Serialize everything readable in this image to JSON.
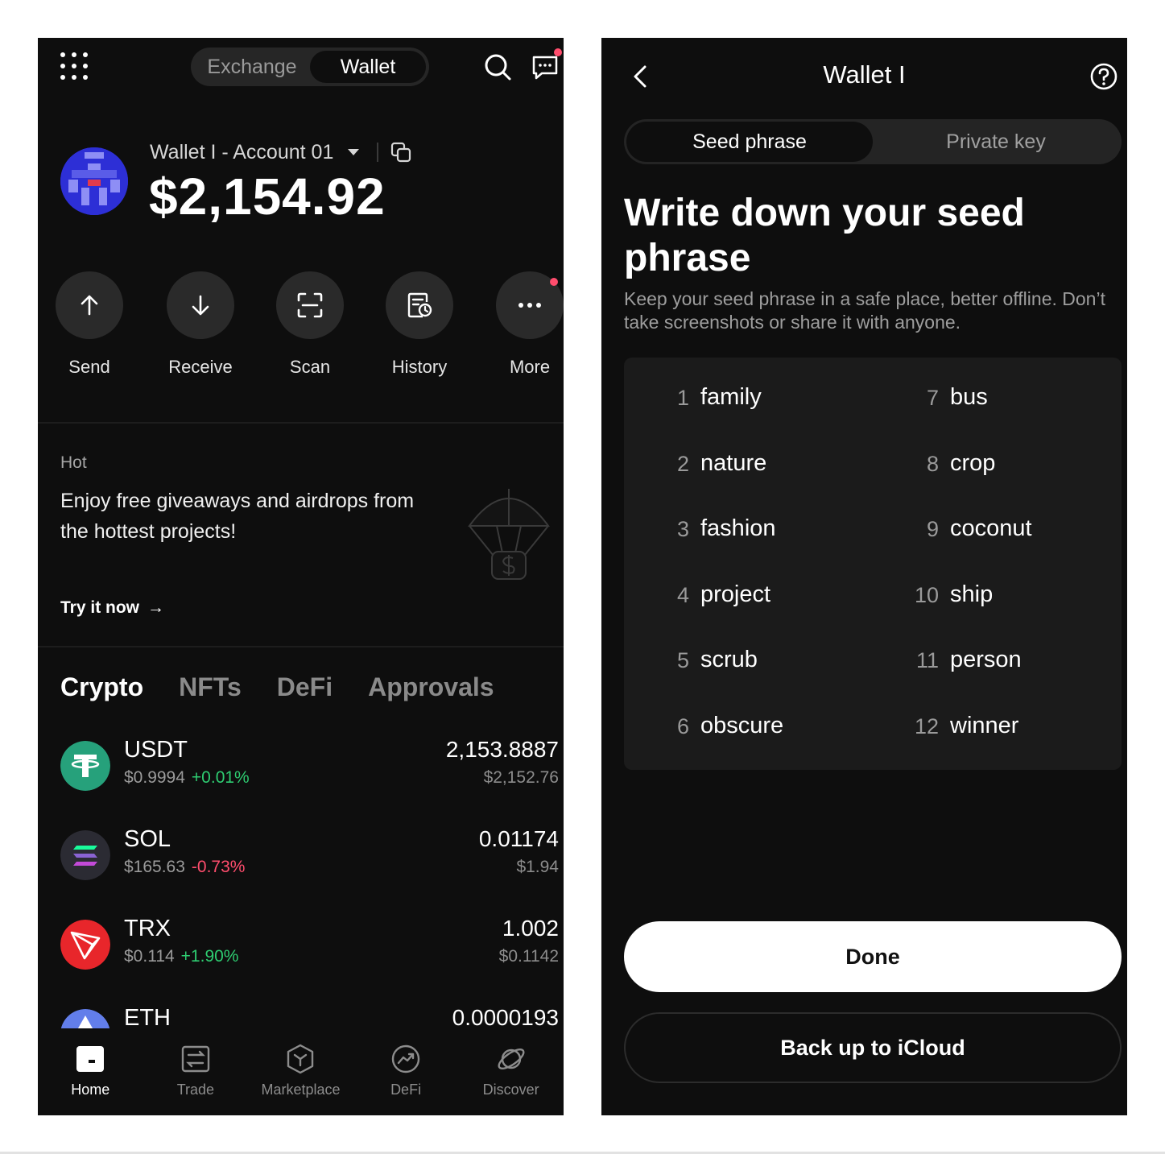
{
  "left": {
    "top_tabs": [
      "Exchange",
      "Wallet"
    ],
    "account_name": "Wallet I - Account 01",
    "balance": "$2,154.92",
    "actions": [
      {
        "label": "Send",
        "icon": "arrow-up-icon"
      },
      {
        "label": "Receive",
        "icon": "arrow-down-icon"
      },
      {
        "label": "Scan",
        "icon": "scan-icon"
      },
      {
        "label": "History",
        "icon": "history-icon"
      },
      {
        "label": "More",
        "icon": "more-icon"
      }
    ],
    "promo": {
      "title": "Hot",
      "text": "Enjoy free giveaways and airdrops from the hottest projects!",
      "cta": "Try it now",
      "cta_arrow": "→"
    },
    "asset_tabs": [
      "Crypto",
      "NFTs",
      "DeFi",
      "Approvals"
    ],
    "tokens": [
      {
        "symbol": "USDT",
        "price": "$0.9994",
        "change": "+0.01%",
        "direction": "up",
        "amount": "2,153.8887",
        "value": "$2,152.76",
        "color": "#26a17b"
      },
      {
        "symbol": "SOL",
        "price": "$165.63",
        "change": "-0.73%",
        "direction": "down",
        "amount": "0.01174",
        "value": "$1.94",
        "color": "#2b2b33"
      },
      {
        "symbol": "TRX",
        "price": "$0.114",
        "change": "+1.90%",
        "direction": "up",
        "amount": "1.002",
        "value": "$0.1142",
        "color": "#e8262b"
      },
      {
        "symbol": "ETH",
        "price": "",
        "change": "",
        "direction": "",
        "amount": "0.0000193",
        "value": "",
        "color": "#627eea"
      }
    ],
    "nav": [
      {
        "label": "Home",
        "icon": "home-icon",
        "active": true
      },
      {
        "label": "Trade",
        "icon": "trade-icon",
        "active": false
      },
      {
        "label": "Marketplace",
        "icon": "marketplace-icon",
        "active": false
      },
      {
        "label": "DeFi",
        "icon": "defi-icon",
        "active": false
      },
      {
        "label": "Discover",
        "icon": "discover-icon",
        "active": false
      }
    ]
  },
  "right": {
    "title": "Wallet I",
    "tabs": [
      "Seed phrase",
      "Private key"
    ],
    "heading": "Write down your seed phrase",
    "description": "Keep your seed phrase in a safe place, better offline. Don’t take screenshots or share it with anyone.",
    "words": [
      {
        "n": "1",
        "word": "family"
      },
      {
        "n": "2",
        "word": "nature"
      },
      {
        "n": "3",
        "word": "fashion"
      },
      {
        "n": "4",
        "word": "project"
      },
      {
        "n": "5",
        "word": "scrub"
      },
      {
        "n": "6",
        "word": "obscure"
      },
      {
        "n": "7",
        "word": "bus"
      },
      {
        "n": "8",
        "word": "crop"
      },
      {
        "n": "9",
        "word": "coconut"
      },
      {
        "n": "10",
        "word": "ship"
      },
      {
        "n": "11",
        "word": "person"
      },
      {
        "n": "12",
        "word": "winner"
      }
    ],
    "done_label": "Done",
    "icloud_label": "Back up to iCloud"
  },
  "colors": {
    "background": "#0e0e0e",
    "positive": "#2ecc71",
    "negative": "#ff4d6d",
    "notification_dot": "#ff4d6d"
  }
}
